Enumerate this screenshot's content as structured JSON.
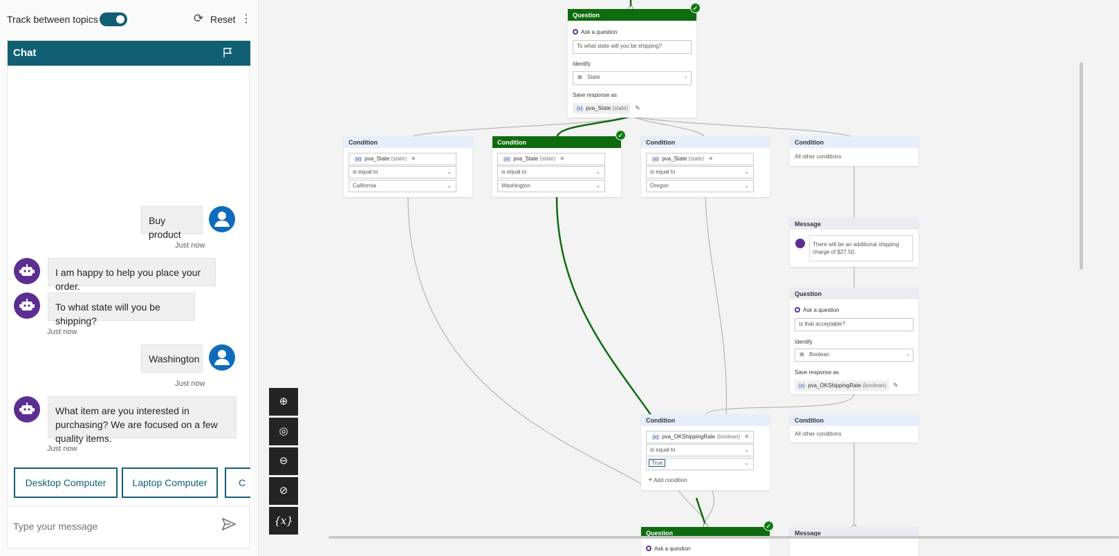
{
  "topbar": {
    "track_label": "Track between topics",
    "reset_label": "Reset"
  },
  "chat": {
    "title": "Chat",
    "messages": [
      {
        "from": "user",
        "text": "Buy product",
        "time": "Just now"
      },
      {
        "from": "bot",
        "text": "I am happy to help you place your order."
      },
      {
        "from": "bot",
        "text": "To what state will you be shipping?",
        "time": "Just now"
      },
      {
        "from": "user",
        "text": "Washington",
        "time": "Just now"
      },
      {
        "from": "bot",
        "text": "What item are you interested in purchasing? We are focused on a few quality items.",
        "time": "Just now"
      }
    ],
    "suggestions": [
      "Desktop Computer",
      "Laptop Computer",
      "C"
    ],
    "input_placeholder": "Type your message"
  },
  "canvas": {
    "question1": {
      "header": "Question",
      "ask": "Ask a question",
      "prompt": "To what state will you be shipping?",
      "identify_label": "Identify",
      "identify_value": "State",
      "save_label": "Save response as",
      "var": "pva_State",
      "var_type": "(state)"
    },
    "conditions": [
      {
        "header": "Condition",
        "var": "pva_State",
        "var_type": "(state)",
        "op": "is equal to",
        "value": "California"
      },
      {
        "header": "Condition",
        "var": "pva_State",
        "var_type": "(state)",
        "op": "is equal to",
        "value": "Washington"
      },
      {
        "header": "Condition",
        "var": "pva_State",
        "var_type": "(state)",
        "op": "is equal to",
        "value": "Oregon"
      },
      {
        "header": "Condition",
        "other": "All other conditions"
      }
    ],
    "message1": {
      "header": "Message",
      "text": "There will be an additional shipping charge of $27.50."
    },
    "question2": {
      "header": "Question",
      "ask": "Ask a question",
      "prompt": "Is that acceptable?",
      "identify_label": "Identify",
      "identify_value": "Boolean",
      "save_label": "Save response as",
      "var": "pva_OKShippingRate",
      "var_type": "(boolean)"
    },
    "condition5": {
      "header": "Condition",
      "var": "pva_OKShippingRate",
      "var_type": "(boolean)",
      "op": "is equal to",
      "value": "True",
      "add": "Add condition"
    },
    "condition6": {
      "header": "Condition",
      "other": "All other conditions"
    },
    "question3": {
      "header": "Question",
      "ask": "Ask a question"
    },
    "message2": {
      "header": "Message"
    },
    "var_chip": "{x}"
  }
}
